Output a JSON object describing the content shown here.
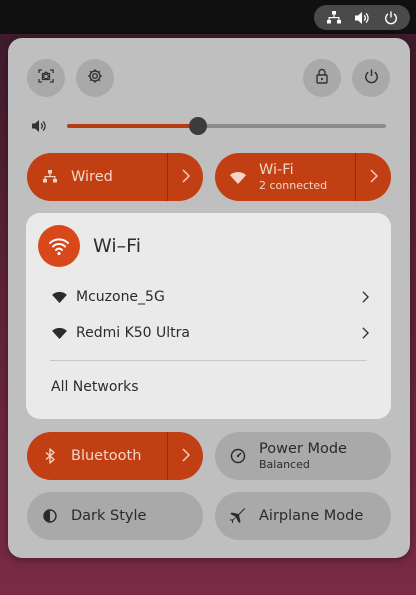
{
  "topbar": {
    "indicators": [
      "network-wired-icon",
      "volume-icon",
      "power-icon"
    ]
  },
  "quick_settings": {
    "top_buttons": [
      "screenshot-icon",
      "settings-gear-icon",
      "lock-icon",
      "power-off-icon"
    ],
    "volume": {
      "level": 0.41,
      "icon": "volume-icon"
    },
    "wired": {
      "label": "Wired",
      "state": "on"
    },
    "wifi": {
      "label": "Wi-Fi",
      "subtitle": "2 connected",
      "state": "on"
    },
    "wifi_menu": {
      "title": "Wi–Fi",
      "networks": [
        {
          "name": "Mcuzone_5G"
        },
        {
          "name": "Redmi K50 Ultra"
        }
      ],
      "all_networks_label": "All Networks"
    },
    "bluetooth": {
      "label": "Bluetooth",
      "state": "on"
    },
    "power_mode": {
      "label": "Power Mode",
      "subtitle": "Balanced"
    },
    "dark_style": {
      "label": "Dark Style"
    },
    "airplane_mode": {
      "label": "Airplane Mode"
    }
  },
  "colors": {
    "accent": "#c13f12",
    "accent_bright": "#d9481a",
    "panel": "#bfbfbf",
    "button": "#a9a9a9"
  }
}
